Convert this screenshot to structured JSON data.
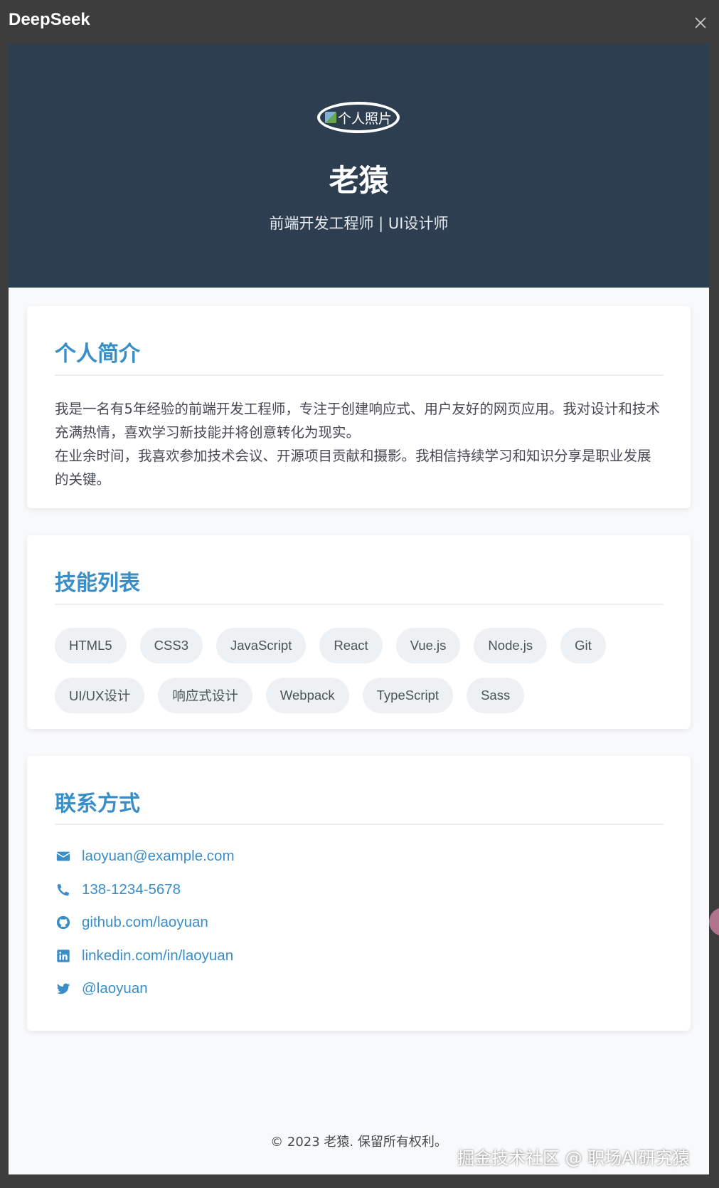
{
  "window": {
    "title": "DeepSeek",
    "close_icon": "close-icon"
  },
  "colors": {
    "hero_bg": "#2d3e50",
    "accent": "#3a8ec8",
    "page_bg": "#f8f9fa",
    "tag_bg": "#eef1f4"
  },
  "hero": {
    "photo_alt": "个人照片",
    "name": "老猿",
    "role": "前端开发工程师 | UI设计师"
  },
  "about": {
    "title": "个人简介",
    "paragraphs": [
      "我是一名有5年经验的前端开发工程师，专注于创建响应式、用户友好的网页应用。我对设计和技术充满热情，喜欢学习新技能并将创意转化为现实。",
      "在业余时间，我喜欢参加技术会议、开源项目贡献和摄影。我相信持续学习和知识分享是职业发展的关键。"
    ]
  },
  "skills": {
    "title": "技能列表",
    "items": [
      "HTML5",
      "CSS3",
      "JavaScript",
      "React",
      "Vue.js",
      "Node.js",
      "Git",
      "UI/UX设计",
      "响应式设计",
      "Webpack",
      "TypeScript",
      "Sass"
    ]
  },
  "contact": {
    "title": "联系方式",
    "items": [
      {
        "icon": "envelope-icon",
        "text": "laoyuan@example.com"
      },
      {
        "icon": "phone-icon",
        "text": "138-1234-5678"
      },
      {
        "icon": "github-icon",
        "text": "github.com/laoyuan"
      },
      {
        "icon": "linkedin-icon",
        "text": "linkedin.com/in/laoyuan"
      },
      {
        "icon": "twitter-icon",
        "text": "@laoyuan"
      }
    ]
  },
  "footer": {
    "text": "© 2023 老猿. 保留所有权利。"
  },
  "watermark": {
    "text": "掘金技术社区 @ 职场AI研究猿"
  }
}
